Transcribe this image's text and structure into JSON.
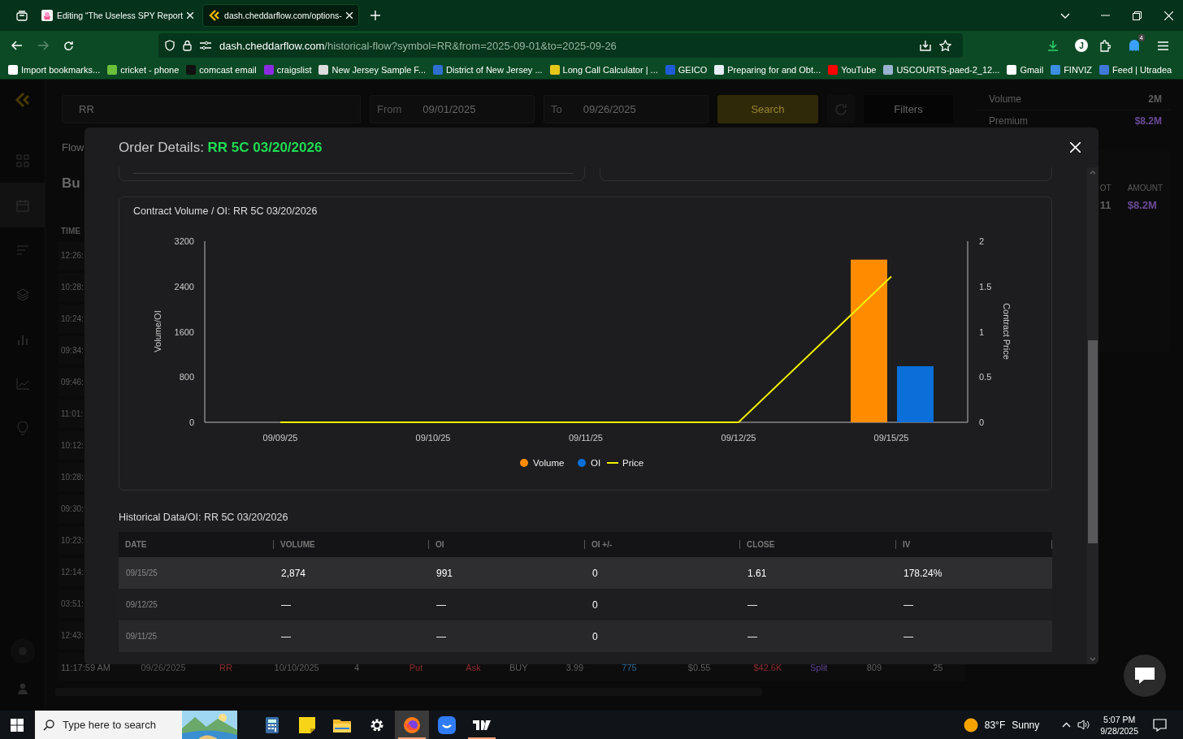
{
  "browser": {
    "tabs": [
      {
        "title": "Editing “The Useless SPY Report",
        "selected": false
      },
      {
        "title": "dash.cheddarflow.com/options-",
        "selected": true
      }
    ],
    "address": {
      "domain": "dash.cheddarflow.com",
      "path": "/historical-flow?symbol=RR&from=2025-09-01&to=2025-09-26"
    },
    "profile_initial": "J",
    "extensions_badge": "4",
    "bookmarks": [
      {
        "label": "Import bookmarks...",
        "color": "#ffffff"
      },
      {
        "label": "cricket - phone",
        "color": "#6cbf3a"
      },
      {
        "label": "comcast email",
        "color": "#111111"
      },
      {
        "label": "craigslist",
        "color": "#8a2be2"
      },
      {
        "label": "New Jersey Sample F...",
        "color": "#dddddd"
      },
      {
        "label": "District of New Jersey ...",
        "color": "#2f6fd0"
      },
      {
        "label": "Long Call Calculator | ...",
        "color": "#e6c619"
      },
      {
        "label": "GEICO",
        "color": "#1f5bd6"
      },
      {
        "label": "Preparing for and Obt...",
        "color": "#e8eef5"
      },
      {
        "label": "YouTube",
        "color": "#ff0000"
      },
      {
        "label": "USCOURTS-paed-2_12...",
        "color": "#9ab3d0"
      },
      {
        "label": "Gmail",
        "color": "#ffffff"
      },
      {
        "label": "FINVIZ",
        "color": "#3b8ee0"
      },
      {
        "label": "Feed | Utradea",
        "color": "#3f78d8"
      }
    ]
  },
  "app": {
    "search": {
      "value": "RR"
    },
    "from": {
      "label": "From",
      "value": "09/01/2025"
    },
    "to": {
      "label": "To",
      "value": "09/26/2025"
    },
    "search_button": "Search",
    "filters_button": "Filters",
    "section_label": "Flow",
    "heading": "Bu",
    "time_header": "TIME",
    "times": [
      "12:26:",
      "10:28:",
      "10:24:",
      "09:34:",
      "09:46:",
      "11:01:",
      "10:12:",
      "10:28:",
      "09:30:",
      "10:23:",
      "12:14:",
      "03:51:",
      "12:43:"
    ],
    "bottom_row": [
      {
        "text": "11:17:59 AM",
        "color": "#5e5e5e"
      },
      {
        "text": "09/26/2025",
        "color": "#555555"
      },
      {
        "text": "RR",
        "color": "#8a2c30"
      },
      {
        "text": "10/10/2025",
        "color": "#5e5e5e"
      },
      {
        "text": "4",
        "color": "#5e5e5e"
      },
      {
        "text": "Put",
        "color": "#8a2c30"
      },
      {
        "text": "Ask",
        "color": "#8a2c30"
      },
      {
        "text": "BUY",
        "color": "#5e5e5e"
      },
      {
        "text": "3.99",
        "color": "#5e5e5e"
      },
      {
        "text": "775",
        "color": "#2c6690"
      },
      {
        "text": "$0.55",
        "color": "#5e5e5e"
      },
      {
        "text": "$42.6K",
        "color": "#8a2c30"
      },
      {
        "text": "Split",
        "color": "#5e4290"
      },
      {
        "text": "809",
        "color": "#5e5e5e"
      },
      {
        "text": "25",
        "color": "#5e5e5e"
      }
    ],
    "summary": [
      {
        "label": "Volume",
        "value": "2M"
      },
      {
        "label": "Premium",
        "value": "$8.2M"
      }
    ],
    "side_table": {
      "columns": [
        "OT",
        "AMOUNT"
      ],
      "values": [
        "11",
        "$8.2M"
      ]
    }
  },
  "modal": {
    "title": "Order Details:",
    "contract": "RR 5C 03/20/2026",
    "chart": {
      "title": "Contract Volume / OI: RR 5C 03/20/2026",
      "chart_data": {
        "type": "bar",
        "legend": "bottom",
        "ylabel": "Volume/OI",
        "y2label": "Contract Price",
        "categories": [
          "09/09/25",
          "09/10/25",
          "09/11/25",
          "09/12/25",
          "09/15/25"
        ],
        "ylim": [
          0,
          3200
        ],
        "yticks": [
          0,
          800,
          1600,
          2400,
          3200
        ],
        "y2lim": [
          0,
          2
        ],
        "y2ticks": [
          0,
          0.5,
          1,
          1.5,
          2
        ],
        "series": [
          {
            "name": "Volume",
            "type": "bar",
            "color": "#ff8c00",
            "values": [
              null,
              null,
              null,
              null,
              2874
            ]
          },
          {
            "name": "OI",
            "type": "bar",
            "color": "#0a6fd8",
            "values": [
              null,
              null,
              null,
              null,
              991
            ]
          },
          {
            "name": "Price",
            "type": "line",
            "axis": "y2",
            "color": "#f2f200",
            "values": [
              0,
              0,
              0,
              0,
              1.61
            ]
          }
        ]
      }
    },
    "table": {
      "title": "Historical Data/OI: RR 5C 03/20/2026",
      "columns": [
        "DATE",
        "VOLUME",
        "OI",
        "OI +/-",
        "CLOSE",
        "IV"
      ],
      "rows": [
        [
          "09/15/25",
          "2,874",
          "991",
          "0",
          "1.61",
          "178.24%"
        ],
        [
          "09/12/25",
          "—",
          "—",
          "0",
          "—",
          "—"
        ],
        [
          "09/11/25",
          "—",
          "—",
          "0",
          "—",
          "—"
        ]
      ]
    }
  },
  "taskbar": {
    "search_placeholder": "Type here to search",
    "apps": [
      {
        "kind": "calculator",
        "running": false,
        "selected": false
      },
      {
        "kind": "notes",
        "running": false,
        "selected": false
      },
      {
        "kind": "folder",
        "running": false,
        "selected": false
      },
      {
        "kind": "settings",
        "running": false,
        "selected": false
      },
      {
        "kind": "firefox",
        "running": true,
        "selected": true
      },
      {
        "kind": "bubble",
        "running": false,
        "selected": false
      },
      {
        "kind": "tv",
        "running": true,
        "selected": false
      }
    ],
    "temperature": "83°F",
    "condition": "Sunny",
    "time": "5:07 PM",
    "date": "9/28/2025"
  }
}
